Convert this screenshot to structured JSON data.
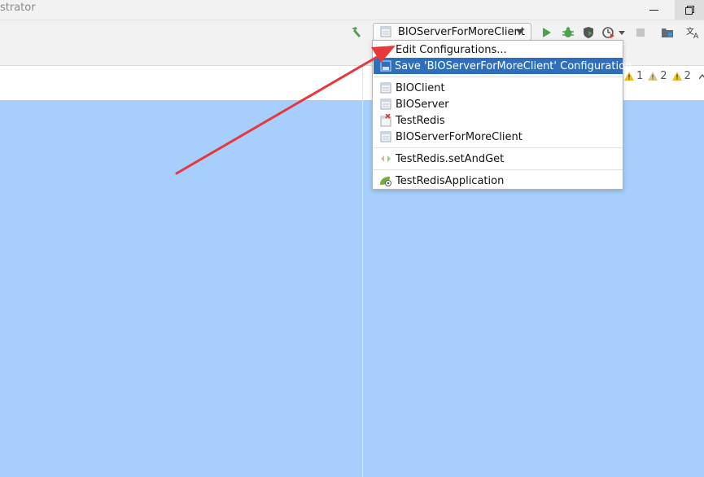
{
  "window": {
    "title_fragment": "strator"
  },
  "toolbar": {
    "build_icon": "hammer-icon",
    "run_config_label": "BIOServerForMoreClient",
    "run_icon": "run-icon",
    "debug_icon": "debug-icon",
    "coverage_icon": "coverage-icon",
    "profile_icon": "profile-icon",
    "stop_icon": "stop-icon",
    "project_structure_icon": "project-structure-icon",
    "translate_icon": "translate-icon"
  },
  "inspections": {
    "warnings_1": "1",
    "warnings_2": "2",
    "warnings_3": "2"
  },
  "menu": {
    "edit_configurations": "Edit Configurations...",
    "save_configuration": "Save 'BIOServerForMoreClient' Configuration",
    "items": [
      {
        "label": "BIOClient",
        "icon": "application-config-icon"
      },
      {
        "label": "BIOServer",
        "icon": "application-config-icon"
      },
      {
        "label": "TestRedis",
        "icon": "invalid-config-icon"
      },
      {
        "label": "BIOServerForMoreClient",
        "icon": "application-config-icon"
      }
    ],
    "junit_item": "TestRedis.setAndGet",
    "spring_item": "TestRedisApplication"
  },
  "colors": {
    "selection": "#2e6fbd",
    "editor_highlight": "#a6cffd",
    "annotation_arrow": "#e8383d",
    "run_green": "#4ca14c",
    "warning_yellow": "#f0c024"
  }
}
